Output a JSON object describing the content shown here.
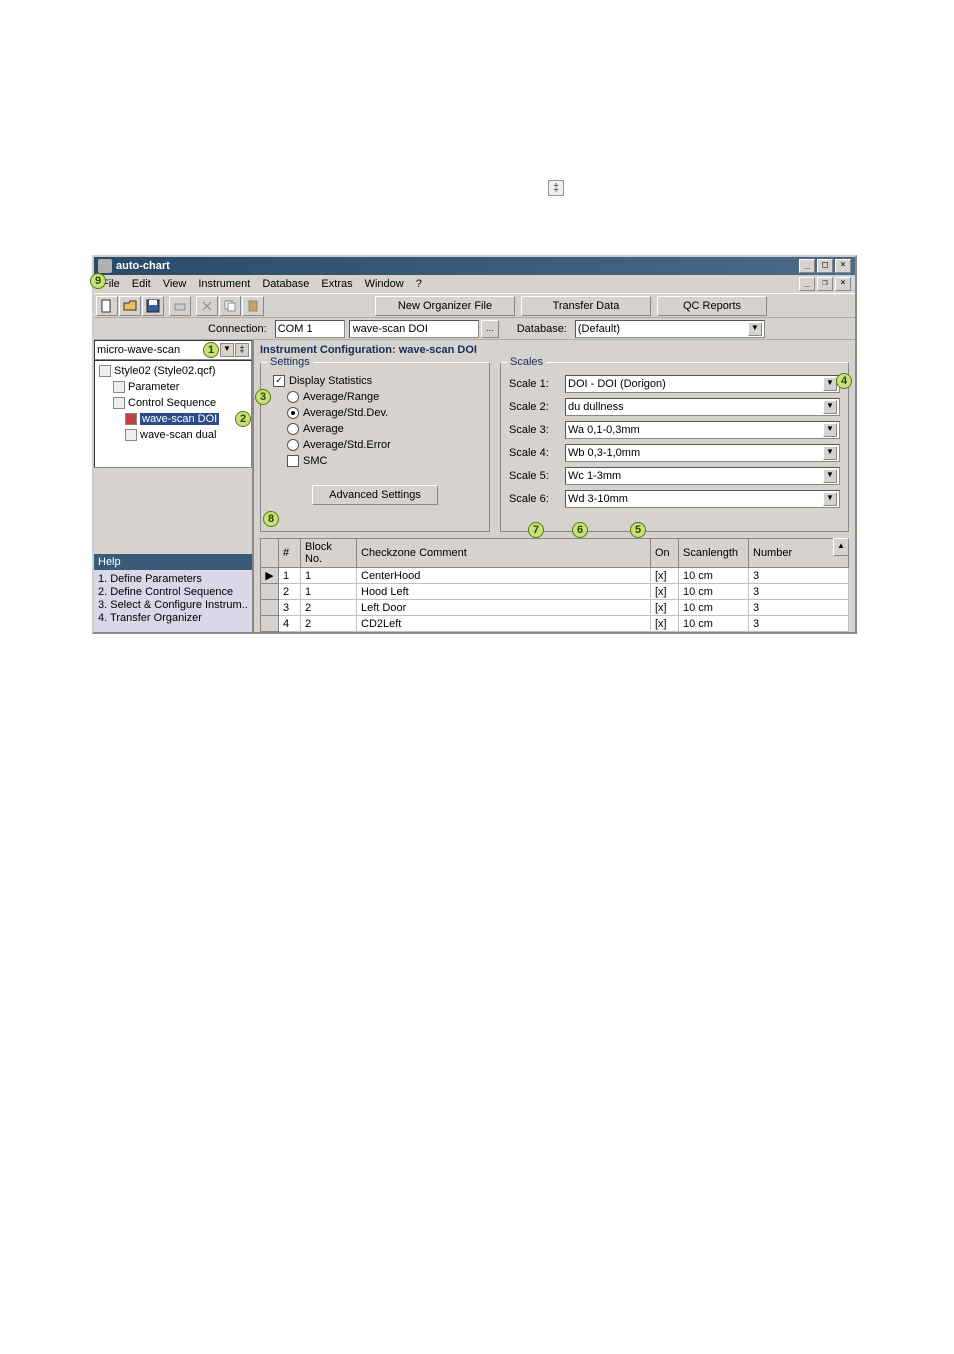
{
  "page_marker": "‡",
  "window": {
    "title": "auto-chart",
    "menubar": [
      "File",
      "Edit",
      "View",
      "Instrument",
      "Database",
      "Extras",
      "Window",
      "?"
    ],
    "annot_menubar": "9",
    "toolbar_big_buttons": [
      "New Organizer File",
      "Transfer Data",
      "QC Reports"
    ],
    "conn": {
      "label": "Connection:",
      "com": "COM 1",
      "device": "wave-scan DOI",
      "browse": "...",
      "db_label": "Database:",
      "db_value": "(Default)"
    }
  },
  "tree": {
    "header": "micro-wave-scan",
    "annot_header": "1",
    "items": [
      {
        "label": "Style02 (Style02.qcf)",
        "indent": 0
      },
      {
        "label": "Parameter",
        "indent": 1
      },
      {
        "label": "Control Sequence",
        "indent": 1
      },
      {
        "label": "wave-scan DOI",
        "indent": 2,
        "selected": true,
        "annot": "2"
      },
      {
        "label": "wave-scan dual",
        "indent": 2
      }
    ]
  },
  "help": {
    "title": "Help",
    "lines": [
      "1. Define Parameters",
      "2. Define Control Sequence",
      "3. Select & Configure Instrum..",
      "4. Transfer Organizer"
    ]
  },
  "config": {
    "header": "Instrument Configuration: wave-scan DOI",
    "settings": {
      "legend": "Settings",
      "annot": "3",
      "display_stats": "Display Statistics",
      "radios": [
        "Average/Range",
        "Average/Std.Dev.",
        "Average",
        "Average/Std.Error"
      ],
      "radio_selected": 1,
      "smc": "SMC",
      "advanced": "Advanced Settings",
      "annot_adv": "8"
    },
    "scales": {
      "legend": "Scales",
      "annot": "4",
      "rows": [
        {
          "label": "Scale 1:",
          "value": "DOI - DOI (Dorigon)"
        },
        {
          "label": "Scale 2:",
          "value": "du dullness"
        },
        {
          "label": "Scale 3:",
          "value": "Wa 0,1-0,3mm"
        },
        {
          "label": "Scale 4:",
          "value": "Wb 0,3-1,0mm"
        },
        {
          "label": "Scale 5:",
          "value": "Wc 1-3mm"
        },
        {
          "label": "Scale 6:",
          "value": "Wd 3-10mm"
        }
      ]
    }
  },
  "grid": {
    "annots": {
      "seven": "7",
      "six": "6",
      "five": "5"
    },
    "headers": [
      "",
      "#",
      "Block No.",
      "Checkzone Comment",
      "On",
      "Scanlength",
      "Number"
    ],
    "rows": [
      {
        "cursor": "▶",
        "n": "1",
        "block": "1",
        "cz": "CenterHood",
        "on": "[x]",
        "scan": "10 cm",
        "num": "3"
      },
      {
        "cursor": "",
        "n": "2",
        "block": "1",
        "cz": "Hood Left",
        "on": "[x]",
        "scan": "10 cm",
        "num": "3"
      },
      {
        "cursor": "",
        "n": "3",
        "block": "2",
        "cz": "Left Door",
        "on": "[x]",
        "scan": "10 cm",
        "num": "3"
      },
      {
        "cursor": "",
        "n": "4",
        "block": "2",
        "cz": "CD2Left",
        "on": "[x]",
        "scan": "10 cm",
        "num": "3"
      }
    ]
  }
}
